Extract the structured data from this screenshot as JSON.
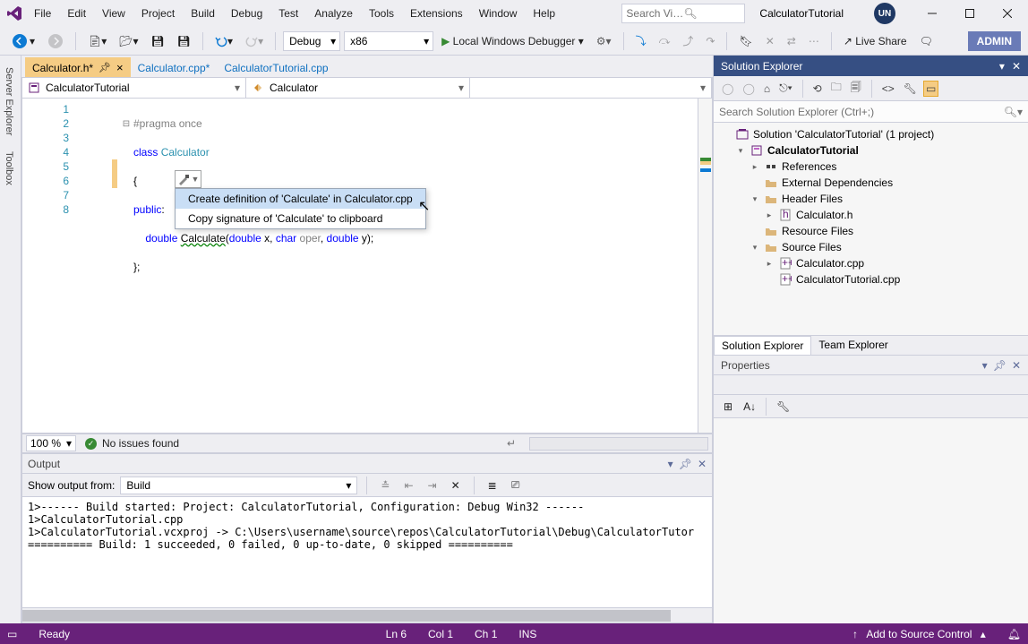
{
  "title_bar": {
    "menus": [
      "File",
      "Edit",
      "View",
      "Project",
      "Build",
      "Debug",
      "Test",
      "Analyze",
      "Tools",
      "Extensions",
      "Window",
      "Help"
    ],
    "search_placeholder": "Search Visual...",
    "solution_name": "CalculatorTutorial",
    "user_initials": "UN"
  },
  "toolbar": {
    "config": "Debug",
    "platform": "x86",
    "debugger": "Local Windows Debugger",
    "live_share": "Live Share",
    "admin": "ADMIN"
  },
  "side_tabs": [
    "Server Explorer",
    "Toolbox"
  ],
  "doc_tabs": [
    {
      "label": "Calculator.h*",
      "active": true,
      "pinned": true
    },
    {
      "label": "Calculator.cpp*",
      "active": false
    },
    {
      "label": "CalculatorTutorial.cpp",
      "active": false
    }
  ],
  "breadcrumb": {
    "project": "CalculatorTutorial",
    "class": "Calculator",
    "member": ""
  },
  "code": {
    "lines": [
      "#pragma once",
      "class Calculator",
      "{",
      "public:",
      "    double Calculate(double x, char oper, double y);",
      "};",
      "",
      ""
    ],
    "line_numbers": [
      1,
      2,
      3,
      4,
      5,
      6,
      7,
      8
    ]
  },
  "quickfix": {
    "items": [
      "Create definition of 'Calculate' in Calculator.cpp",
      "Copy signature of 'Calculate' to clipboard"
    ]
  },
  "editor_status": {
    "zoom": "100 %",
    "issues": "No issues found"
  },
  "output": {
    "title": "Output",
    "from_label": "Show output from:",
    "from_value": "Build",
    "text": "1>------ Build started: Project: CalculatorTutorial, Configuration: Debug Win32 ------\n1>CalculatorTutorial.cpp\n1>CalculatorTutorial.vcxproj -> C:\\Users\\username\\source\\repos\\CalculatorTutorial\\Debug\\CalculatorTutor\n========== Build: 1 succeeded, 0 failed, 0 up-to-date, 0 skipped =========="
  },
  "solution_explorer": {
    "title": "Solution Explorer",
    "search_placeholder": "Search Solution Explorer (Ctrl+;)",
    "tree": [
      {
        "depth": 0,
        "exp": "",
        "icon": "solution",
        "label": "Solution 'CalculatorTutorial' (1 project)"
      },
      {
        "depth": 1,
        "exp": "▾",
        "icon": "project",
        "label": "CalculatorTutorial",
        "bold": true
      },
      {
        "depth": 2,
        "exp": "▸",
        "icon": "references",
        "label": "References"
      },
      {
        "depth": 2,
        "exp": "",
        "icon": "folder",
        "label": "External Dependencies"
      },
      {
        "depth": 2,
        "exp": "▾",
        "icon": "folder",
        "label": "Header Files"
      },
      {
        "depth": 3,
        "exp": "▸",
        "icon": "h-file",
        "label": "Calculator.h"
      },
      {
        "depth": 2,
        "exp": "",
        "icon": "folder",
        "label": "Resource Files"
      },
      {
        "depth": 2,
        "exp": "▾",
        "icon": "folder",
        "label": "Source Files"
      },
      {
        "depth": 3,
        "exp": "▸",
        "icon": "cpp-file",
        "label": "Calculator.cpp"
      },
      {
        "depth": 3,
        "exp": "",
        "icon": "cpp-file",
        "label": "CalculatorTutorial.cpp"
      }
    ],
    "bottom_tabs": [
      "Solution Explorer",
      "Team Explorer"
    ]
  },
  "properties": {
    "title": "Properties"
  },
  "status_bar": {
    "ready": "Ready",
    "line": "Ln 6",
    "col": "Col 1",
    "ch": "Ch 1",
    "ins": "INS",
    "source_control": "Add to Source Control"
  }
}
